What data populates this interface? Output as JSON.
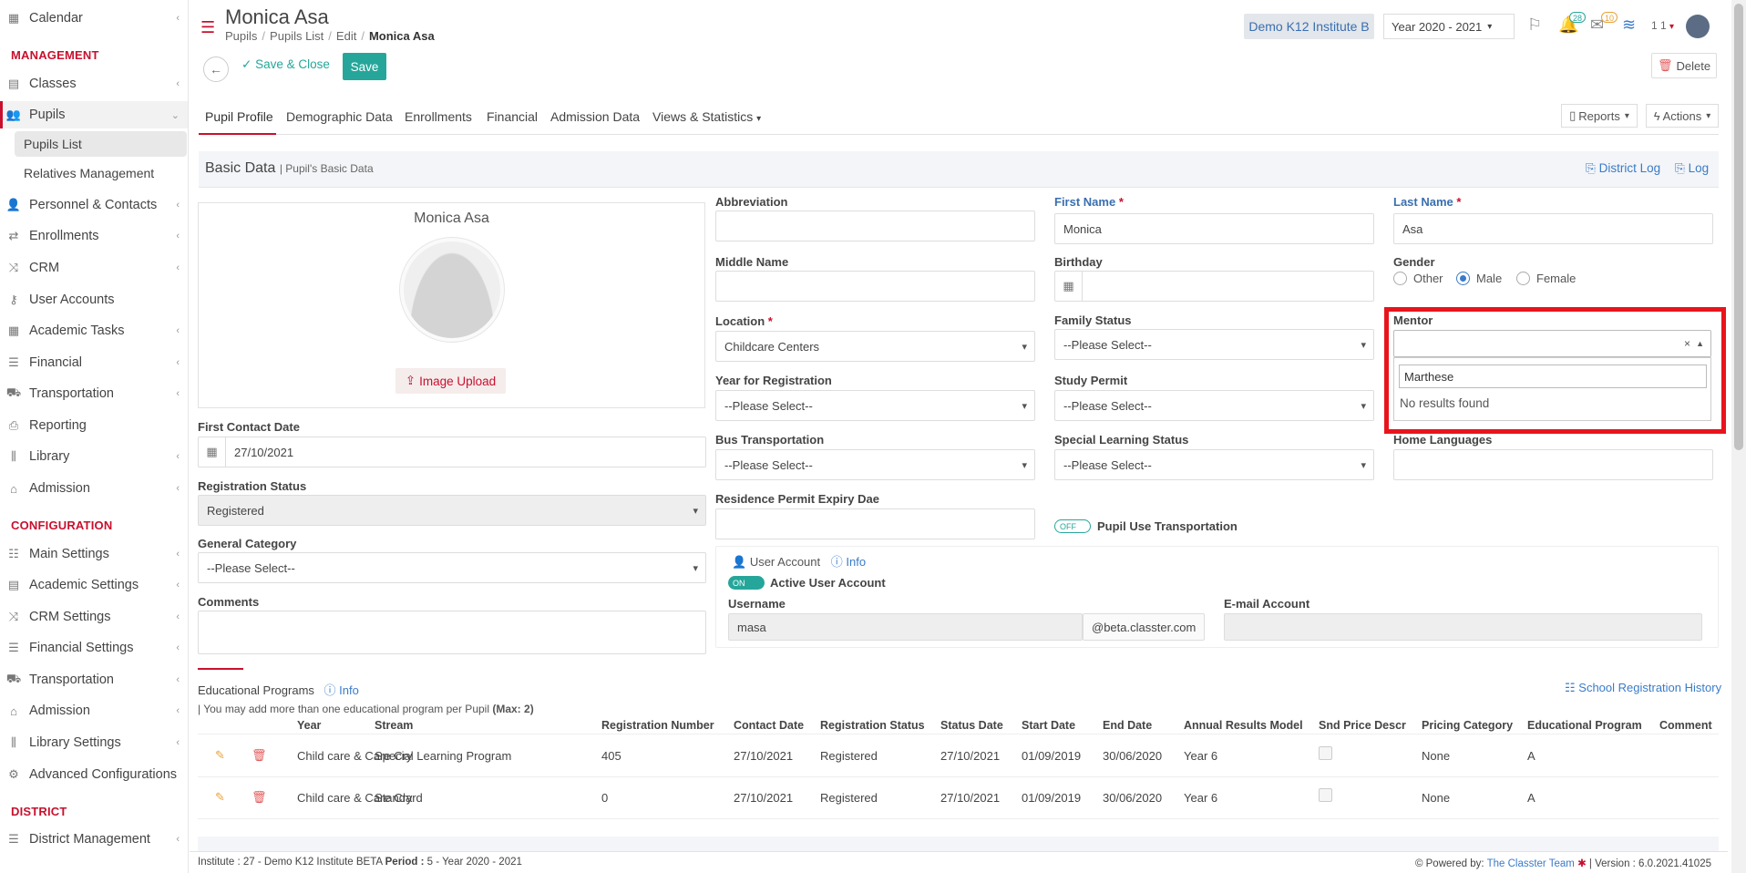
{
  "sidebar": {
    "items": [
      {
        "label": "Calendar",
        "icon": "calendar-icon"
      },
      {
        "label": "Classes",
        "icon": "classes-icon"
      },
      {
        "label": "Pupils",
        "icon": "pupils-icon"
      },
      {
        "label": "Personnel & Contacts",
        "icon": "personnel-icon"
      },
      {
        "label": "Enrollments",
        "icon": "enrollments-icon"
      },
      {
        "label": "CRM",
        "icon": "crm-icon"
      },
      {
        "label": "User Accounts",
        "icon": "key-icon"
      },
      {
        "label": "Academic Tasks",
        "icon": "tasks-icon"
      },
      {
        "label": "Financial",
        "icon": "coins-icon"
      },
      {
        "label": "Transportation",
        "icon": "bus-icon"
      },
      {
        "label": "Reporting",
        "icon": "printer-icon"
      },
      {
        "label": "Library",
        "icon": "library-icon"
      },
      {
        "label": "Admission",
        "icon": "bank-icon"
      }
    ],
    "config_items": [
      {
        "label": "Main Settings",
        "icon": "sliders-icon"
      },
      {
        "label": "Academic Settings",
        "icon": "classes-icon"
      },
      {
        "label": "CRM Settings",
        "icon": "crm-icon"
      },
      {
        "label": "Financial Settings",
        "icon": "coins-icon"
      },
      {
        "label": "Transportation",
        "icon": "bus-icon"
      },
      {
        "label": "Admission",
        "icon": "bank-icon"
      },
      {
        "label": "Library Settings",
        "icon": "library-icon"
      },
      {
        "label": "Advanced Configurations",
        "icon": "gears-icon"
      }
    ],
    "district_items": [
      {
        "label": "District Management",
        "icon": "menu-icon"
      }
    ],
    "sub_items": [
      "Pupils List",
      "Relatives Management"
    ],
    "headers": {
      "management": "MANAGEMENT",
      "configuration": "CONFIGURATION",
      "district": "DISTRICT"
    }
  },
  "header": {
    "title": "Monica Asa",
    "breadcrumbs": [
      "Pupils",
      "Pupils List",
      "Edit",
      "Monica Asa"
    ],
    "institute": "Demo K12 Institute B",
    "year": "Year 2020 - 2021",
    "notif_count": "28",
    "mail_count": "10",
    "user_short": "1 1"
  },
  "toolbar": {
    "save_close": "Save & Close",
    "save": "Save",
    "delete": "Delete"
  },
  "tabs": [
    "Pupil Profile",
    "Demographic Data",
    "Enrollments",
    "Financial",
    "Admission Data",
    "Views & Statistics"
  ],
  "tab_actions": {
    "reports": "Reports",
    "actions": "Actions"
  },
  "section": {
    "title": "Basic Data",
    "subtitle": "Pupil's Basic Data",
    "district_log": "District Log",
    "log": "Log"
  },
  "profile": {
    "name": "Monica Asa",
    "upload": "Image Upload"
  },
  "form": {
    "first_contact_label": "First Contact Date",
    "first_contact": "27/10/2021",
    "reg_status_label": "Registration Status",
    "reg_status": "Registered",
    "gen_cat_label": "General Category",
    "gen_cat": "--Please Select--",
    "comments_label": "Comments",
    "abbreviation_label": "Abbreviation",
    "middle_name_label": "Middle Name",
    "location_label": "Location",
    "location": "Childcare Centers",
    "year_reg_label": "Year for Registration",
    "year_reg": "--Please Select--",
    "bus_label": "Bus Transportation",
    "bus": "--Please Select--",
    "residence_label": "Residence Permit Expiry Dae",
    "first_name_label": "First Name",
    "first_name": "Monica",
    "birthday_label": "Birthday",
    "family_label": "Family Status",
    "family": "--Please Select--",
    "study_label": "Study Permit",
    "study": "--Please Select--",
    "sls_label": "Special Learning Status",
    "sls": "--Please Select--",
    "pupil_transport_label": "Pupil Use Transportation",
    "off": "OFF",
    "last_name_label": "Last Name",
    "last_name": "Asa",
    "gender_label": "Gender",
    "gender_options": [
      "Other",
      "Male",
      "Female"
    ],
    "mentor_label": "Mentor",
    "mentor_search": "Marthese",
    "no_results": "No results found",
    "home_lang_label": "Home Languages",
    "user_account_label": "User Account",
    "info": "Info",
    "on": "ON",
    "active_user_label": "Active User Account",
    "username_label": "Username",
    "username": "masa",
    "domain": "@beta.classter.com",
    "email_label": "E-mail Account"
  },
  "programs": {
    "title": "Educational Programs",
    "info": "Info",
    "note": "| You may add more than one educational program per Pupil",
    "max": "(Max: 2)",
    "history": "School Registration History",
    "columns": [
      "Year",
      "Stream",
      "Registration Number",
      "Contact Date",
      "Registration Status",
      "Status Date",
      "Start Date",
      "End Date",
      "Annual Results Model",
      "Snd Price Descr",
      "Pricing Category",
      "Educational Program",
      "Comment"
    ],
    "rows": [
      [
        "Child care & Care Cry",
        "Special Learning Program",
        "405",
        "27/10/2021",
        "Registered",
        "27/10/2021",
        "01/09/2019",
        "30/06/2020",
        "Year 6",
        "",
        "None",
        "A",
        ""
      ],
      [
        "Child care & Care Cry",
        "Standard",
        "0",
        "27/10/2021",
        "Registered",
        "27/10/2021",
        "01/09/2019",
        "30/06/2020",
        "Year 6",
        "",
        "None",
        "A",
        ""
      ]
    ]
  },
  "footer": {
    "inst_label": "Institute :",
    "inst_value": "27 - Demo K12 Institute BETA",
    "period_label": "Period :",
    "period_value": "5 - Year 2020 - 2021",
    "powered": "Powered by:",
    "team": "The Classter Team",
    "version": "| Version : 6.0.2021.41025"
  },
  "colors": {
    "brand": "#c8102e",
    "accent": "#26a69a",
    "link": "#3a7bc8",
    "highlight": "#e8141c"
  }
}
